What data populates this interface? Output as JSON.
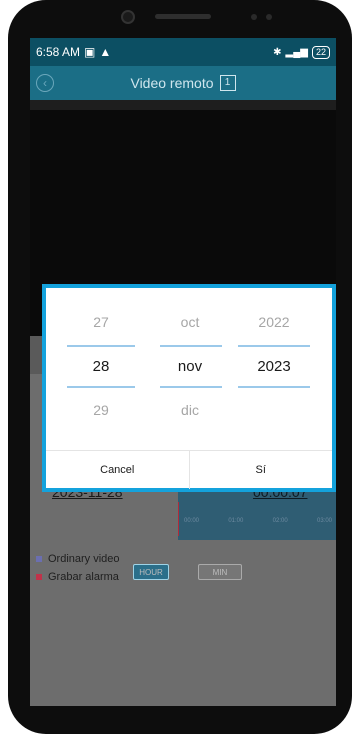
{
  "status_bar": {
    "time": "6:58 AM",
    "battery": "22"
  },
  "app_bar": {
    "title": "Video remoto",
    "counter": "1"
  },
  "timeline": {
    "date": "2023-11-28",
    "time": "00:00:07",
    "ticks": [
      "00:00",
      "01:00",
      "02:00",
      "03:00"
    ]
  },
  "legend": {
    "ordinary": "Ordinary video",
    "alarm": "Grabar alarma"
  },
  "modes": {
    "hour": "HOUR",
    "min": "MIN"
  },
  "date_picker": {
    "day": {
      "prev": "27",
      "selected": "28",
      "next": "29"
    },
    "month": {
      "prev": "oct",
      "selected": "nov",
      "next": "dic"
    },
    "year": {
      "prev": "2022",
      "selected": "2023",
      "next": ""
    },
    "cancel_label": "Cancel",
    "confirm_label": "Sí"
  },
  "colors": {
    "accent": "#14a2dc",
    "app_bar": "#1b6e86",
    "status_bar": "#0c4f63",
    "legend_ordinary": "#6b6fb0",
    "legend_alarm": "#c0324a"
  }
}
